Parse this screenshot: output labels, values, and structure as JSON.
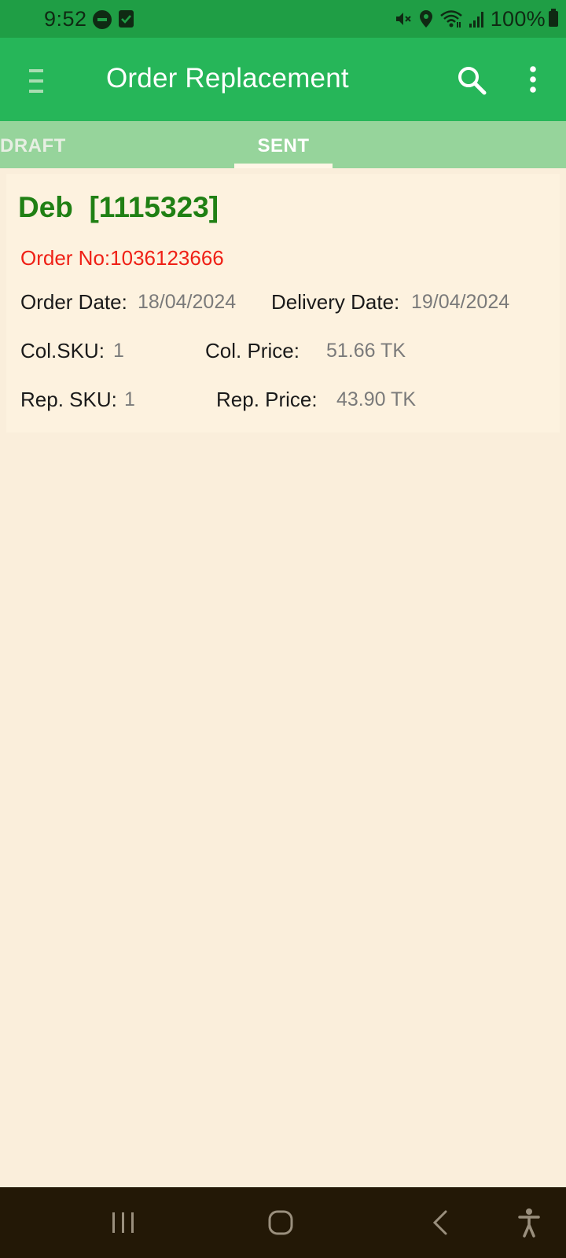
{
  "status_bar": {
    "time": "9:52",
    "battery": "100%"
  },
  "app_bar": {
    "title": "Order Replacement"
  },
  "tabs": [
    {
      "label": "DRAFT",
      "active": false
    },
    {
      "label": "SENT",
      "active": true
    }
  ],
  "order": {
    "retailer": "Deb  [1115323]",
    "order_no": "Order No:1036123666",
    "order_date_label": "Order Date:",
    "order_date": "18/04/2024",
    "delivery_date_label": "Delivery Date:",
    "delivery_date": "19/04/2024",
    "col_sku_label": "Col.SKU:",
    "col_sku": "1",
    "col_price_label": "Col. Price:",
    "col_price": "51.66 TK",
    "rep_sku_label": "Rep. SKU:",
    "rep_sku": "1",
    "rep_price_label": "Rep. Price:",
    "rep_price": "43.90 TK"
  },
  "colors": {
    "status_bar": "#1f9e45",
    "app_bar": "#26b659",
    "tab_bar": "#96d49b",
    "background": "#faeedb",
    "card": "#fdf2df",
    "retailer_text": "#208014",
    "order_no_text": "#ef2016",
    "nav_bar": "#231806"
  },
  "icons": {
    "status": [
      "dnd-icon",
      "checklist-icon",
      "mute-icon",
      "location-icon",
      "wifi-icon",
      "signal-icon",
      "battery-icon"
    ],
    "app_bar": [
      "menu-icon",
      "search-icon",
      "more-icon"
    ],
    "nav": [
      "recents-icon",
      "home-icon",
      "back-icon",
      "accessibility-icon"
    ]
  }
}
